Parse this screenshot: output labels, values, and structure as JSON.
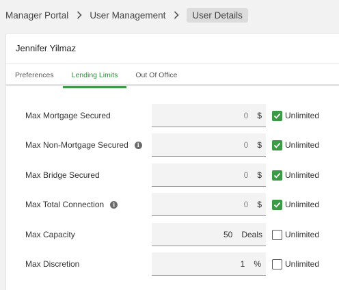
{
  "breadcrumb": {
    "items": [
      "Manager Portal",
      "User Management"
    ],
    "current": "User Details"
  },
  "card": {
    "title": "Jennifer Yilmaz",
    "tabs": [
      "Preferences",
      "Lending Limits",
      "Out Of Office"
    ],
    "active_tab": "Lending Limits"
  },
  "form": {
    "rows": [
      {
        "label": "Max Mortgage Secured",
        "value": "0",
        "unit": "$",
        "unlimited": true,
        "info": false
      },
      {
        "label": "Max Non-Mortgage Secured",
        "value": "0",
        "unit": "$",
        "unlimited": true,
        "info": true
      },
      {
        "label": "Max Bridge Secured",
        "value": "0",
        "unit": "$",
        "unlimited": true,
        "info": false
      },
      {
        "label": "Max Total Connection",
        "value": "0",
        "unit": "$",
        "unlimited": true,
        "info": true
      },
      {
        "label": "Max Capacity",
        "value": "50",
        "unit": "Deals",
        "unlimited": false,
        "info": false
      },
      {
        "label": "Max Discretion",
        "value": "1",
        "unit": "%",
        "unlimited": false,
        "info": false
      }
    ],
    "unlimited_label": "Unlimited"
  },
  "colors": {
    "accent": "#3c9a47",
    "background": "#f2f2f2"
  },
  "icons": {
    "separator": "chevron-right-icon",
    "info": "info-icon",
    "check": "checkmark-icon"
  }
}
